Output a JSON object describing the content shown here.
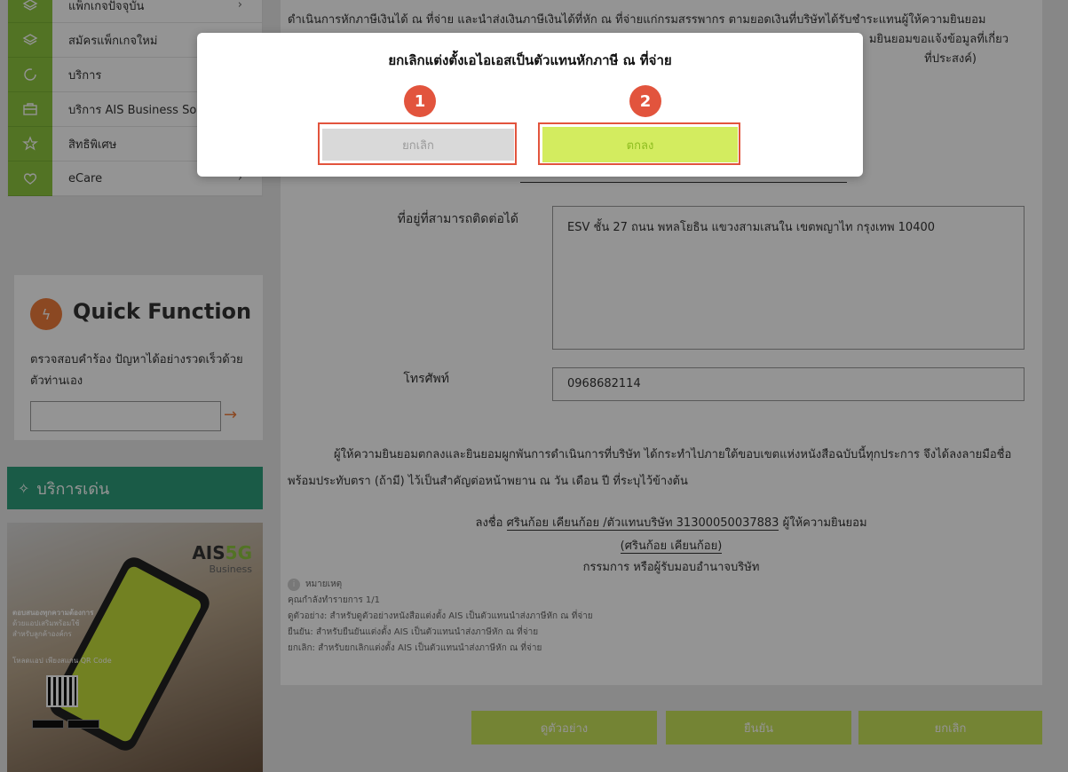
{
  "colors": {
    "accent_green": "#8dc63f",
    "button_green": "#c9e35a",
    "ok_green": "#d3ec5f",
    "teal": "#2e9e7a",
    "orange": "#ef7d3b",
    "annotation_red": "#e2543d"
  },
  "sidebar": {
    "items": [
      {
        "label": "แพ็กเกจปัจจุบัน",
        "icon": "layers-icon",
        "chevron": "›"
      },
      {
        "label": "สมัครแพ็กเกจใหม่",
        "icon": "layers-icon",
        "chevron": ""
      },
      {
        "label": "บริการ",
        "icon": "refresh-icon",
        "chevron": ""
      },
      {
        "label": "บริการ AIS Business So",
        "icon": "briefcase-icon",
        "chevron": ""
      },
      {
        "label": "สิทธิพิเศษ",
        "icon": "star-icon",
        "chevron": "›"
      },
      {
        "label": "eCare",
        "icon": "heart-icon",
        "chevron": "›"
      }
    ],
    "quick_function": {
      "title": "Quick Function",
      "description": "ตรวจสอบคำร้อง ปัญหาได้อย่างรวดเร็วด้วยตัวท่านเอง",
      "input_value": "",
      "arrow": "→"
    },
    "featured": {
      "label": "บริการเด่น"
    },
    "promo": {
      "brand": "AIS",
      "brand_5g": "5G",
      "brand_sub": "Business",
      "headline": "ตอบสนองทุกความต้องการ",
      "line2": "ด้วยแอปเสริมพร้อมใช้",
      "line3": "สำหรับลูกค้าองค์กร",
      "qr_caption": "โหลดแอป เพียงสแกน QR Code"
    }
  },
  "main": {
    "top_paragraph": "ดำเนินการหักภาษีเงินได้ ณ ที่จ่าย และนำส่งเงินภาษีเงินได้ที่หัก ณ ที่จ่ายแก่กรมสรรพากร ตามยอดเงินที่บริษัทได้รับชำระแทนผู้ให้ความยินยอม",
    "top_paragraph_2": "มยินยอมขอแจ้งข้อมูลที่เกี่ยว",
    "top_paragraph_3": "ที่ประสงค์)",
    "address_label": "ที่อยู่ที่สามารถติดต่อได้",
    "address_value": "ESV ชั้น 27 ถนน พหลโยธิน แขวงสามเสนใน เขตพญาไท กรุงเทพ 10400",
    "phone_label": "โทรศัพท์",
    "phone_value": "0968682114",
    "consent_text": "ผู้ให้ความยินยอมตกลงและยินยอมผูกพันการดำเนินการที่บริษัท ได้กระทำไปภายใต้ขอบเขตแห่งหนังสือฉบับนี้ทุกประการ จึงได้ลงลายมือชื่อ พร้อมประทับตรา (ถ้ามี) ไว้เป็นสำคัญต่อหน้าพยาน ณ วัน เดือน ปี ที่ระบุไว้ข้างต้น",
    "sign_prefix": "ลงชื่อ",
    "sign_name": "ศรินก้อย เคียนก้อย /ตัวแทนบริษัท 31300050037883",
    "sign_suffix": "ผู้ให้ความยินยอม",
    "sign_name_paren": "(ศรินก้อย เคียนก้อย)",
    "sign_role": "กรรมการ หรือผู้รับมอบอำนาจบริษัท",
    "note": {
      "icon": "info-icon",
      "title": "หมายเหตุ",
      "lines": [
        "คุณกำลังทำรายการ 1/1",
        "ดูตัวอย่าง: สำหรับดูตัวอย่างหนังสือแต่งตั้ง AIS เป็นตัวแทนนำส่งภาษีหัก ณ ที่จ่าย",
        "ยืนยัน: สำหรับยืนยันแต่งตั้ง AIS เป็นตัวแทนนำส่งภาษีหัก ณ ที่จ่าย",
        "ยกเลิก: สำหรับยกเลิกแต่งตั้ง AIS เป็นตัวแทนนำส่งภาษีหัก ณ ที่จ่าย"
      ]
    },
    "actions": {
      "preview": "ดูตัวอย่าง",
      "confirm": "ยืนยัน",
      "cancel": "ยกเลิก"
    }
  },
  "modal": {
    "title": "ยกเลิกแต่งตั้งเอไอเอสเป็นตัวแทนหักภาษี ณ ที่จ่าย",
    "cancel_label": "ยกเลิก",
    "ok_label": "ตกลง",
    "marker_1": "1",
    "marker_2": "2"
  }
}
